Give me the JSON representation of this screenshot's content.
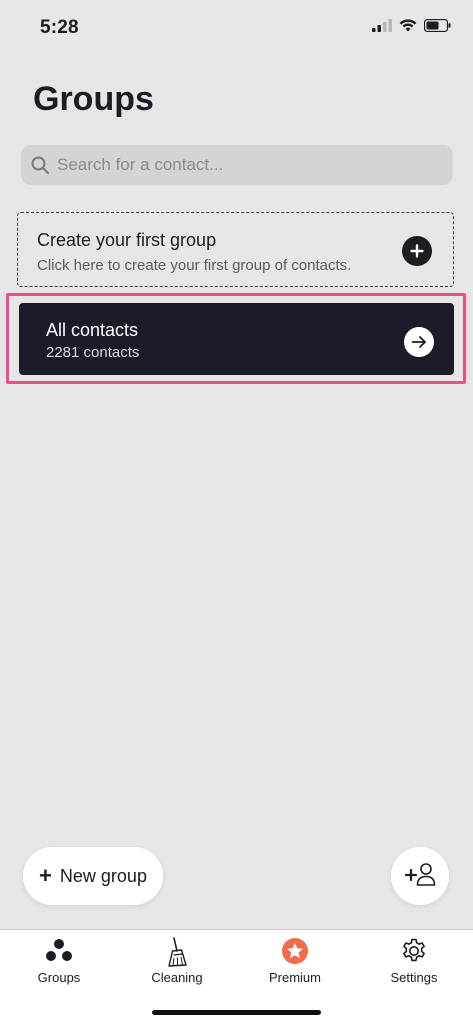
{
  "status_bar": {
    "time": "5:28"
  },
  "header": {
    "title": "Groups"
  },
  "search": {
    "placeholder": "Search for a contact..."
  },
  "create_group_card": {
    "title": "Create your first group",
    "subtitle": "Click here to create your first group of contacts.",
    "icon": "plus-circle-icon"
  },
  "all_contacts_card": {
    "title": "All contacts",
    "count_text": "2281 contacts",
    "icon": "arrow-right-icon"
  },
  "fab": {
    "new_group_icon": "+",
    "new_group_label": "New group",
    "add_contact_icon": "add-person-icon"
  },
  "tabs": [
    {
      "label": "Groups",
      "icon": "groups-icon"
    },
    {
      "label": "Cleaning",
      "icon": "broom-icon"
    },
    {
      "label": "Premium",
      "icon": "star-badge-icon"
    },
    {
      "label": "Settings",
      "icon": "gear-icon"
    }
  ],
  "colors": {
    "background": "#e6e6e6",
    "dark_card": "#1c1c29",
    "highlight": "#f04c8c",
    "premium_accent": "#f26b4a"
  }
}
